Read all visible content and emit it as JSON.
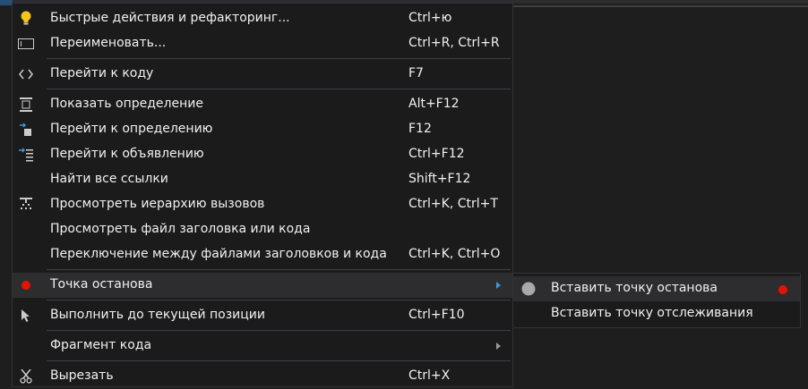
{
  "menu": {
    "items": [
      {
        "label": "Быстрые действия и рефакторинг...",
        "shortcut": "Ctrl+ю",
        "icon": "lightbulb-icon"
      },
      {
        "label": "Переименовать...",
        "shortcut": "Ctrl+R, Ctrl+R",
        "icon": "rename-icon"
      },
      {
        "label": "Перейти к коду",
        "shortcut": "F7",
        "icon": "code-brackets-icon"
      },
      {
        "label": "Показать определение",
        "shortcut": "Alt+F12",
        "icon": "peek-definition-icon"
      },
      {
        "label": "Перейти к определению",
        "shortcut": "F12",
        "icon": "goto-definition-icon"
      },
      {
        "label": "Перейти к объявлению",
        "shortcut": "Ctrl+F12",
        "icon": "goto-declaration-icon"
      },
      {
        "label": "Найти все ссылки",
        "shortcut": "Shift+F12",
        "icon": ""
      },
      {
        "label": "Просмотреть иерархию вызовов",
        "shortcut": "Ctrl+K, Ctrl+T",
        "icon": "call-hierarchy-icon"
      },
      {
        "label": "Просмотреть файл заголовка или кода",
        "shortcut": "",
        "icon": ""
      },
      {
        "label": "Переключение между файлами заголовков и кода",
        "shortcut": "Ctrl+K, Ctrl+O",
        "icon": ""
      },
      {
        "label": "Точка останова",
        "shortcut": "",
        "icon": "breakpoint-icon",
        "submenu": true
      },
      {
        "label": "Выполнить до текущей позиции",
        "shortcut": "Ctrl+F10",
        "icon": "run-to-cursor-icon"
      },
      {
        "label": "Фрагмент кода",
        "shortcut": "",
        "icon": "",
        "submenu": true
      },
      {
        "label": "Вырезать",
        "shortcut": "Ctrl+X",
        "icon": "cut-icon"
      }
    ]
  },
  "submenu": {
    "items": [
      {
        "label": "Вставить точку останова",
        "icon": "insert-breakpoint-icon"
      },
      {
        "label": "Вставить точку отслеживания",
        "icon": ""
      }
    ]
  },
  "colors": {
    "background": "#1b1b1c",
    "highlight": "#2d2d30",
    "breakpoint": "#e51400",
    "submenu_arrow": "#3a96dd"
  }
}
